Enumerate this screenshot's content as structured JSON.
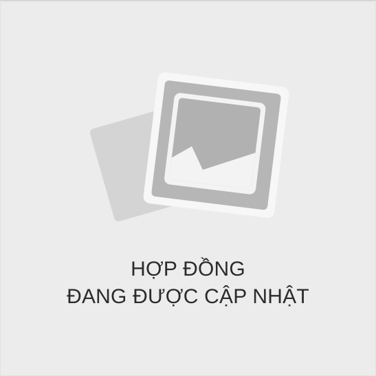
{
  "placeholder": {
    "icon": "image-placeholder-icon",
    "line1": "HỢP ĐỒNG",
    "line2": "ĐANG ĐƯỢC CẬP NHẬT"
  },
  "colors": {
    "background": "#ececec",
    "text": "#2b2b2b",
    "photo_back": "#d2d2d2",
    "photo_front_border": "#f6f6f6",
    "photo_front_fill": "#b4b4b4"
  }
}
